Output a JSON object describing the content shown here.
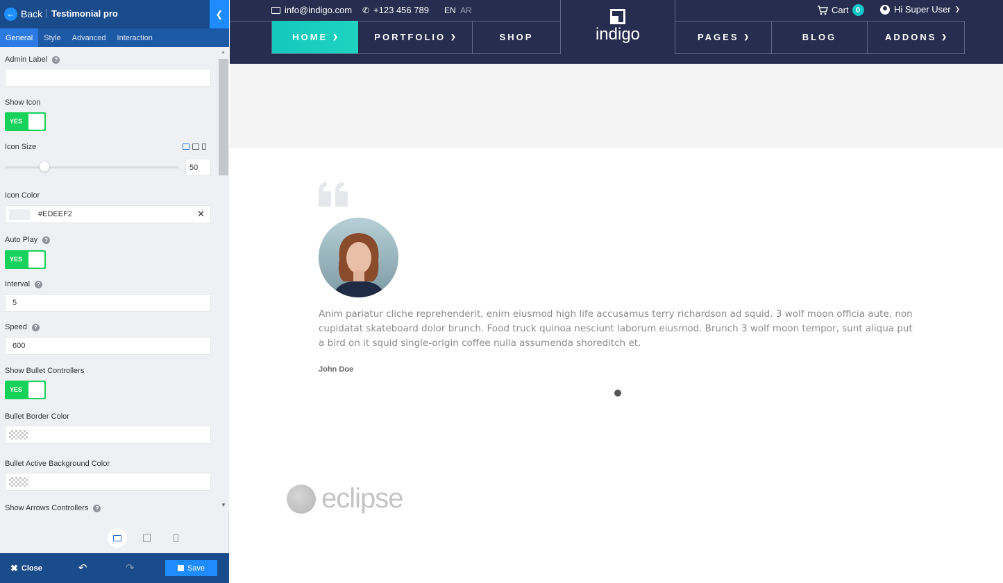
{
  "panel": {
    "back_label": "Back",
    "title": "Testimonial pro",
    "tabs": [
      "General",
      "Style",
      "Advanced",
      "Interaction"
    ],
    "active_tab": "General",
    "fields": {
      "admin_label": {
        "label": "Admin Label",
        "value": ""
      },
      "show_icon": {
        "label": "Show Icon",
        "toggle": "YES"
      },
      "icon_size": {
        "label": "Icon Size",
        "value": "50",
        "slider_percent": 23
      },
      "icon_color": {
        "label": "Icon Color",
        "value": "#EDEEF2",
        "swatch": "#EDEEF2"
      },
      "auto_play": {
        "label": "Auto Play",
        "toggle": "YES"
      },
      "interval": {
        "label": "Interval",
        "value": "5"
      },
      "speed": {
        "label": "Speed",
        "value": "600"
      },
      "show_bullets": {
        "label": "Show Bullet Controllers",
        "toggle": "YES"
      },
      "bullet_border_color": {
        "label": "Bullet Border Color"
      },
      "bullet_active_bg": {
        "label": "Bullet Active Background Color"
      },
      "show_arrows": {
        "label": "Show Arrows Controllers"
      }
    },
    "footer": {
      "close_label": "Close",
      "save_label": "Save"
    },
    "colors": {
      "header": "#1a4c8c",
      "accent": "#1e8cff",
      "toggle_on": "#16d15a"
    }
  },
  "site": {
    "email": "info@indigo.com",
    "phone": "+123 456 789",
    "lang_active": "EN",
    "lang_other": "AR",
    "cart_label": "Cart",
    "cart_count": "0",
    "user_label": "Hi Super User",
    "logo": "indigo",
    "nav": [
      "HOME",
      "PORTFOLIO",
      "SHOP",
      "PAGES",
      "BLOG",
      "ADDONS"
    ],
    "colors": {
      "header_bg": "#272d4e",
      "nav_active": "#14c9bd"
    }
  },
  "testimonial": {
    "text": "Anim pariatur cliche reprehenderit, enim eiusmod high life accusamus terry richardson ad squid. 3 wolf moon officia aute, non cupidatat skateboard dolor brunch. Food truck quinoa nesciunt laborum eiusmod. Brunch 3 wolf moon tempor, sunt aliqua put a bird on it squid single-origin coffee nulla assumenda shoreditch et.",
    "author": "John Doe",
    "client_logo": "eclipse"
  }
}
